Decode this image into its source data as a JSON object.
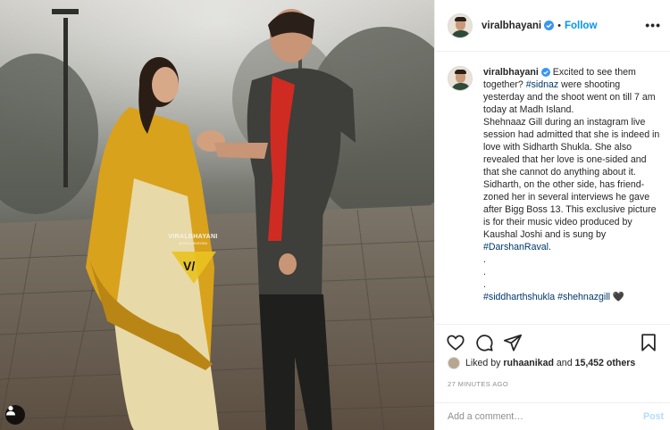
{
  "post": {
    "username": "viralbhayani",
    "follow_label": "Follow",
    "more_label": "•••",
    "separator": "•"
  },
  "photo": {
    "watermark_name": "VIRALBHAYANI",
    "watermark_sub": "@VIRALBHAYANI"
  },
  "caption": {
    "username": "viralbhayani",
    "text_1": " Excited to see them together? ",
    "tag_1": "#sidnaz",
    "text_2": " were shooting yesterday and the shoot went on till 7 am today at Madh Island.",
    "text_3": "Shehnaaz Gill during an instagram live session had admitted that she is indeed in love with Sidharth Shukla. She also revealed that her love is one-sided and that she cannot do anything about it. Sidharth, on the other side, has friend-zoned her in several interviews he gave after Bigg Boss 13. This exclusive picture is for their music video produced by Kaushal Joshi and is sung by ",
    "tag_2": "#DarshanRaval",
    "text_4": ".",
    "dots": [
      ".",
      ".",
      "."
    ],
    "tag_3": "#siddharthshukla",
    "tag_4": "#shehnazgill",
    "heart": "🖤"
  },
  "likes": {
    "prefix": "Liked by ",
    "liker": "ruhaanikad",
    "middle": " and ",
    "count": "15,452 others"
  },
  "timestamp": "27 MINUTES AGO",
  "comment": {
    "placeholder": "Add a comment…",
    "post_label": "Post"
  },
  "icons": {
    "like": "heart-outline-icon",
    "comment": "speech-bubble-icon",
    "share": "paper-plane-icon",
    "save": "bookmark-icon",
    "verified": "verified-badge-icon",
    "tagged_user": "person-icon"
  },
  "colors": {
    "link": "#0095f6",
    "hashtag": "#00376b",
    "muted": "#8e8e8e",
    "post_disabled": "#b3dbff"
  }
}
